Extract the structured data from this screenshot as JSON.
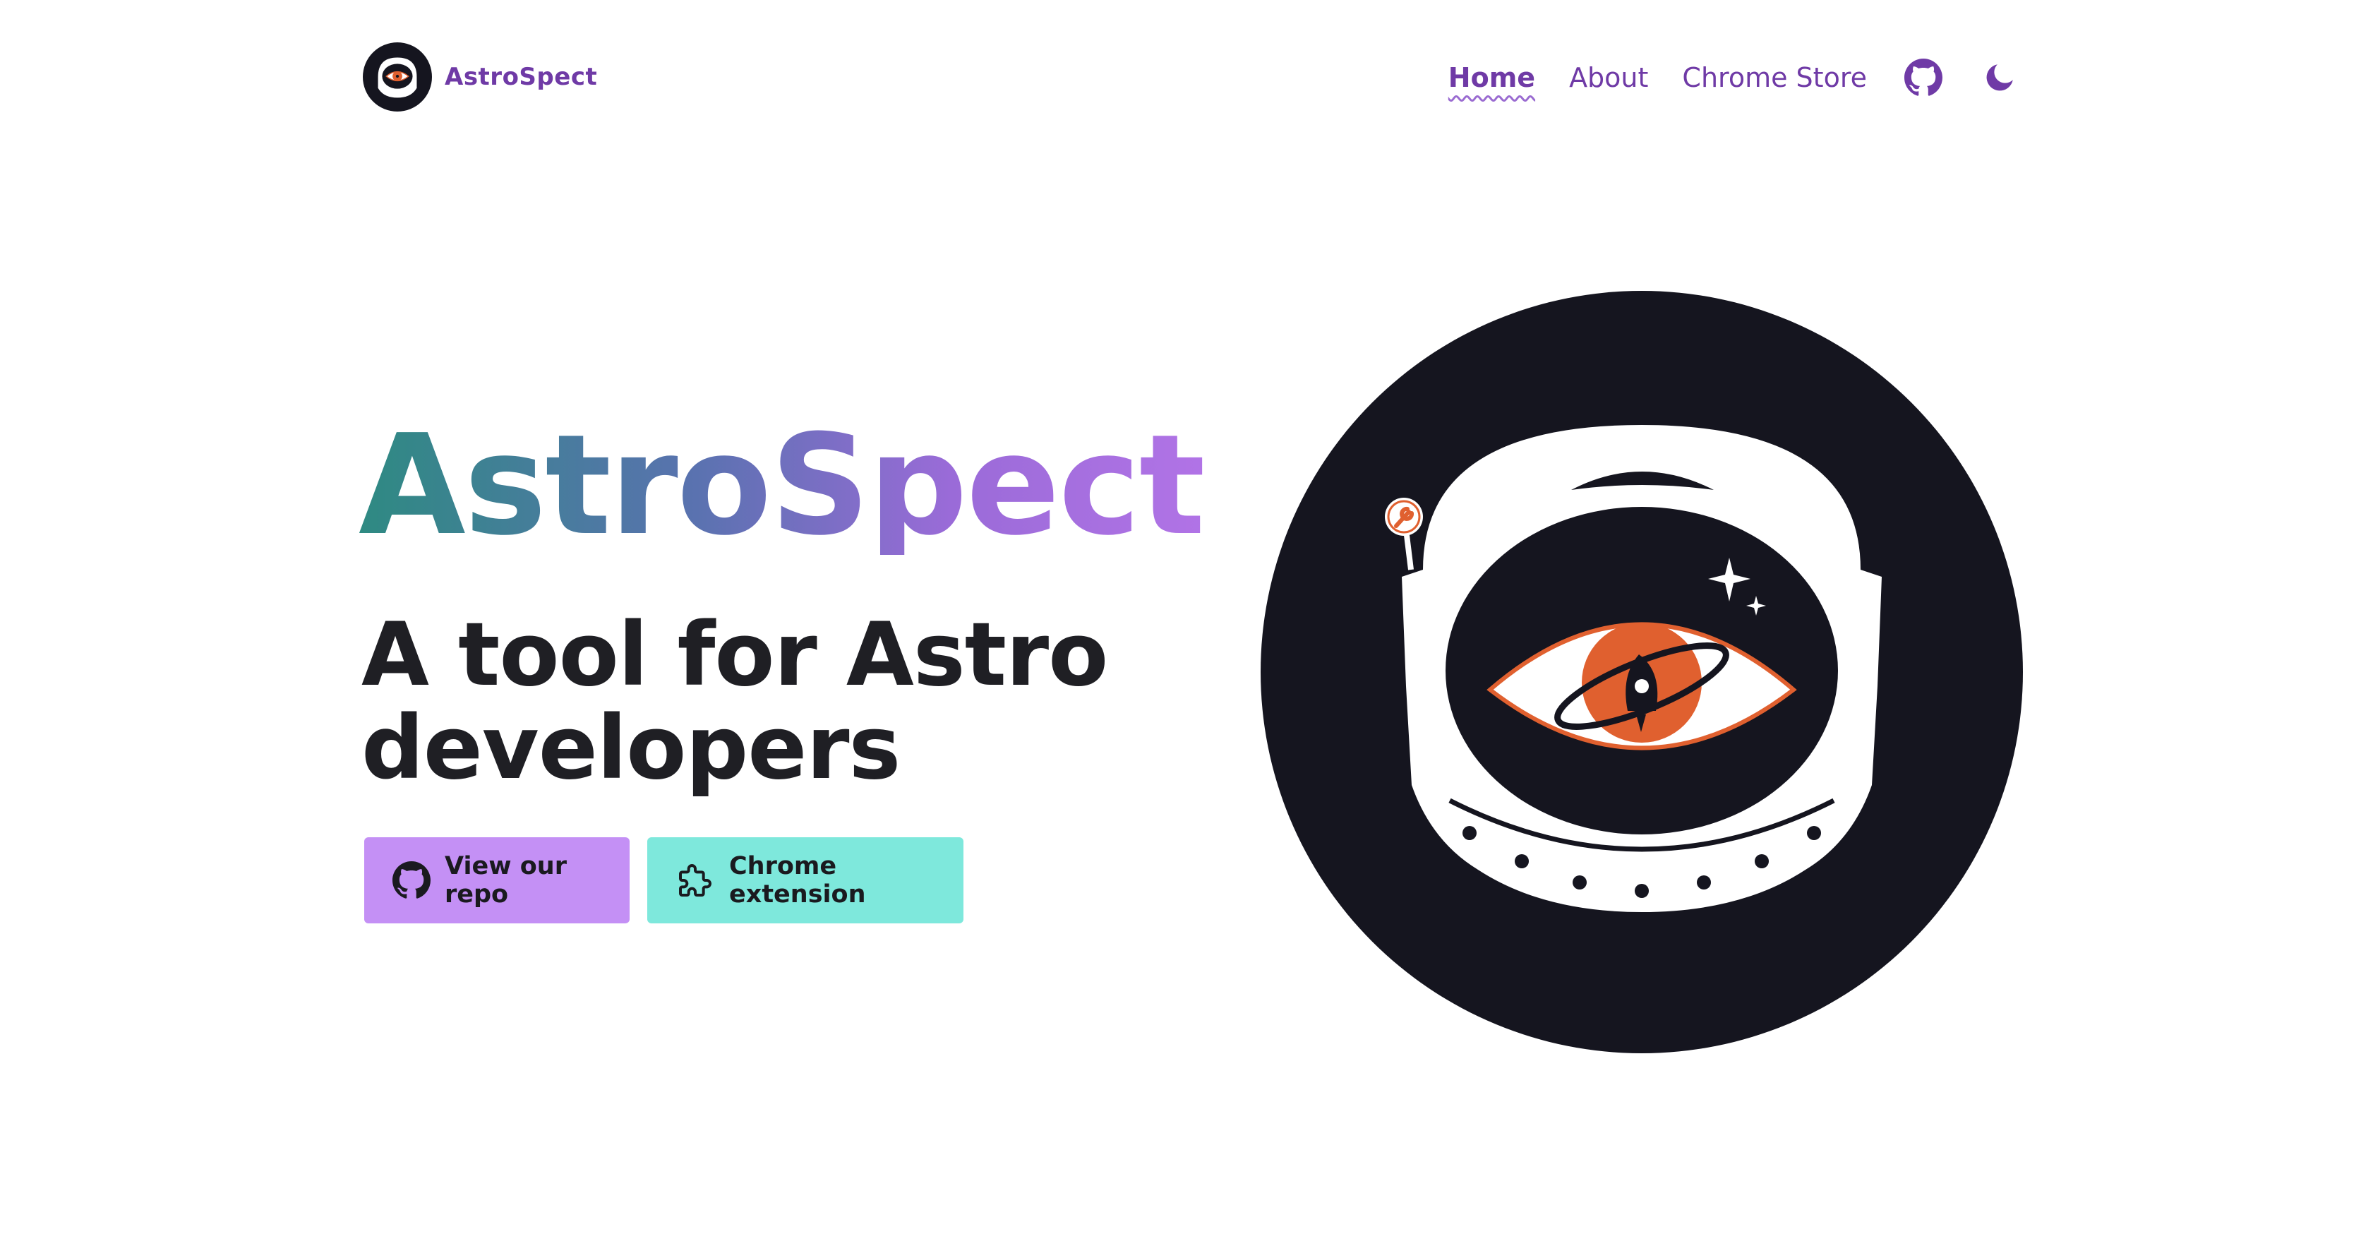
{
  "brand": {
    "name": "AstroSpect",
    "logo_icon": "astronaut-eye-logo-icon"
  },
  "nav": {
    "items": [
      {
        "label": "Home",
        "active": true
      },
      {
        "label": "About",
        "active": false
      },
      {
        "label": "Chrome Store",
        "active": false
      }
    ],
    "github_icon": "github-icon",
    "theme_icon": "moon-icon"
  },
  "hero": {
    "title": "AstroSpect",
    "subtitle": "A tool for Astro developers",
    "buttons": [
      {
        "label": "View our repo",
        "icon": "github-icon",
        "color": "#c490f5"
      },
      {
        "label": "Chrome extension",
        "icon": "puzzle-icon",
        "color": "#7ee8dc"
      }
    ]
  },
  "colors": {
    "accent": "#6f3aa6",
    "title_gradient": [
      "#2e8a82",
      "#5a72b0",
      "#9a6bd8",
      "#b173e6"
    ],
    "illustration_bg": "#15151f",
    "eye_iris": "#e0602f"
  }
}
